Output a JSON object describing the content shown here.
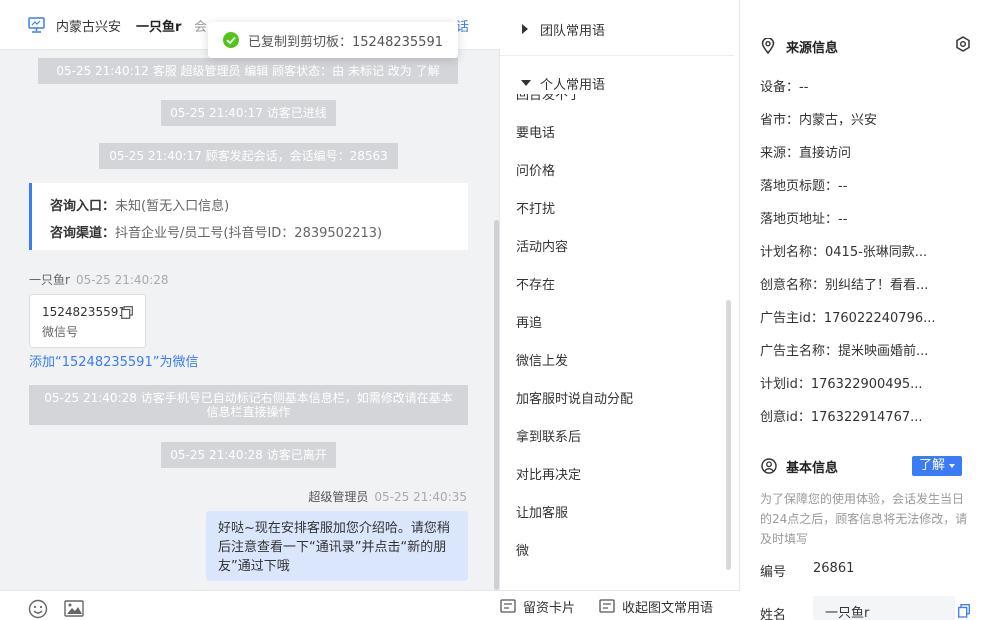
{
  "header": {
    "location": "内蒙古兴安",
    "customer_name": "一只鱼r",
    "extra_text": "会",
    "extra_link": "话"
  },
  "toast": {
    "text": "已复制到剪切板：15248235591"
  },
  "chat": {
    "system_messages": [
      "05-25 21:40:12 客服 超级管理员 编辑 顾客状态：由 未标记 改为 了解",
      "05-25 21:40:17 访客已进线",
      "05-25 21:40:17 顾客发起会话，会话编号：28563",
      "05-25 21:40:28 访客手机号已自动标记右侧基本信息栏，如需修改请在基本信息栏直接操作",
      "05-25 21:40:28 访客已离开"
    ],
    "entry_card": {
      "row1_label": "咨询入口：",
      "row1_value": "未知(暂无入口信息)",
      "row2_label": "咨询渠道：",
      "row2_value": "抖音企业号/员工号(抖音号ID：2839502213)"
    },
    "visitor": {
      "name": "一只鱼r",
      "time": "05-25 21:40:28",
      "wechat_number": "15248235591",
      "wechat_label": "微信号",
      "add_link": "添加“15248235591”为微信"
    },
    "agent": {
      "name": "超级管理员",
      "time": "05-25 21:40:35",
      "message": "好哒~现在安排客服加您介绍哈。请您稍后注意查看一下“通讯录”并点击“新的朋友”通过下哦"
    }
  },
  "phrases": {
    "team_title": "团队常用语",
    "personal_title": "个人常用语",
    "clipped_item": "回台发不了",
    "items": [
      "要电话",
      "问价格",
      "不打扰",
      "活动内容",
      "不存在",
      "再追",
      "微信上发",
      "加客服时说自动分配",
      "拿到联系后",
      "对比再决定",
      "让加客服",
      "微"
    ],
    "footer_card": "留资卡片",
    "footer_phrase": "收起图文常用语"
  },
  "info": {
    "source_title": "来源信息",
    "source_rows": [
      "设备：--",
      "省市：内蒙古，兴安",
      "来源：直接访问",
      "落地页标题：--",
      "落地页地址：--",
      "计划名称：0415-张琳同款...",
      "创意名称：别纠结了！看看...",
      "广告主id：176022240796...",
      "广告主名称：提米映画婚前...",
      "计划id：176322900495...",
      "创意id：176322914767..."
    ],
    "basic_title": "基本信息",
    "status_button": "了解",
    "hint": "为了保障您的使用体验，会话发生当日的24点之后，顾客信息将无法修改，请及时填写",
    "number_label": "编号",
    "number_value": "26861",
    "name_label": "姓名",
    "name_value": "一只鱼r"
  }
}
